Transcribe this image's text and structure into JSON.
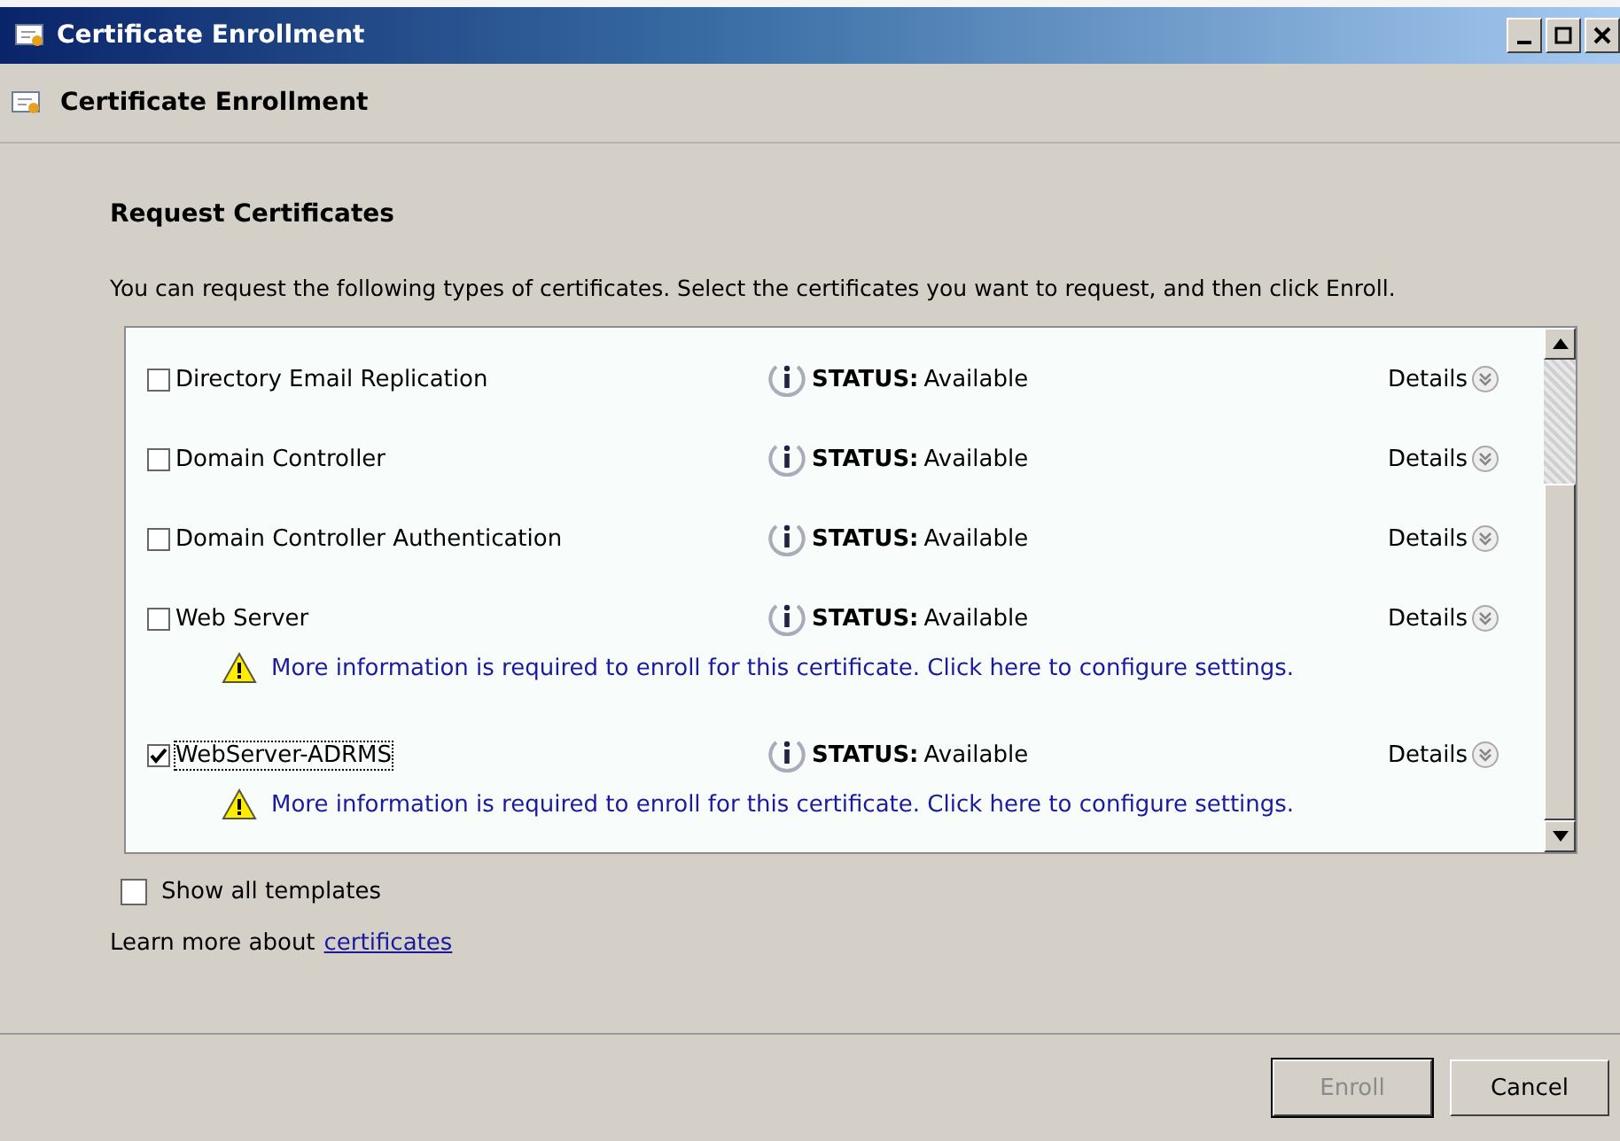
{
  "window": {
    "title": "Certificate Enrollment"
  },
  "header": {
    "title": "Certificate Enrollment"
  },
  "section": {
    "title": "Request Certificates",
    "description": "You can request the following types of certificates. Select the certificates you want to request, and then click Enroll."
  },
  "certificates": [
    {
      "name": "Directory Email Replication",
      "checked": false,
      "status_label": "STATUS:",
      "status_value": "Available",
      "details": "Details"
    },
    {
      "name": "Domain Controller",
      "checked": false,
      "status_label": "STATUS:",
      "status_value": "Available",
      "details": "Details"
    },
    {
      "name": "Domain Controller Authentication",
      "checked": false,
      "status_label": "STATUS:",
      "status_value": "Available",
      "details": "Details"
    },
    {
      "name": "Web Server",
      "checked": false,
      "status_label": "STATUS:",
      "status_value": "Available",
      "details": "Details",
      "warning": "More information is required to enroll for this certificate. Click here to configure settings."
    },
    {
      "name": "WebServer-ADRMS",
      "checked": true,
      "status_label": "STATUS:",
      "status_value": "Available",
      "details": "Details",
      "warning": "More information is required to enroll for this certificate. Click here to configure settings."
    }
  ],
  "show_all_templates": {
    "label": "Show all templates",
    "checked": false
  },
  "learn_more": {
    "text": "Learn more about",
    "link": "certificates"
  },
  "buttons": [
    {
      "label": "Enroll",
      "disabled": true
    },
    {
      "label": "Cancel",
      "disabled": false
    }
  ]
}
